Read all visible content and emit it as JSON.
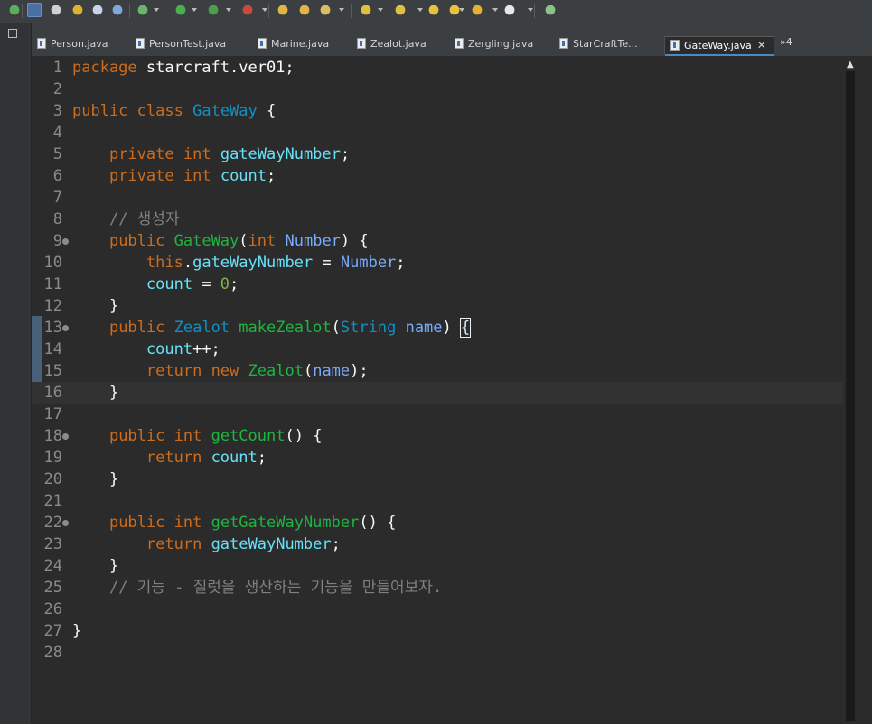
{
  "toolbar": {
    "buttons": [
      "debug-icon",
      "wand-icon",
      "settings-icon",
      "package-icon",
      "document-icon",
      "pilcrow-icon",
      "bug-icon",
      "run-icon",
      "run-coverage-icon",
      "external-tools-icon",
      "open-folder-icon",
      "open-task-icon",
      "brush-icon",
      "next-annotation-icon",
      "previous-annotation-icon",
      "back-edit-icon",
      "forward-edit-icon",
      "back-icon",
      "forward-icon",
      "open-perspective-icon"
    ]
  },
  "tabs": [
    {
      "label": "Person.java",
      "active": false
    },
    {
      "label": "PersonTest.java",
      "active": false
    },
    {
      "label": "Marine.java",
      "active": false
    },
    {
      "label": "Zealot.java",
      "active": false
    },
    {
      "label": "Zergling.java",
      "active": false
    },
    {
      "label": "StarCraftTe...",
      "active": false
    },
    {
      "label": "GateWay.java",
      "active": true
    }
  ],
  "tabs_overflow": "»4",
  "editor": {
    "current_line": 16,
    "lines": [
      {
        "n": "1",
        "fold": false,
        "tokens": [
          [
            "kw",
            "package"
          ],
          [
            "pl",
            " starcraft.ver01;"
          ]
        ]
      },
      {
        "n": "2",
        "fold": false,
        "tokens": []
      },
      {
        "n": "3",
        "fold": false,
        "tokens": [
          [
            "kw",
            "public"
          ],
          [
            "pl",
            " "
          ],
          [
            "kw",
            "class"
          ],
          [
            "pl",
            " "
          ],
          [
            "ty",
            "GateWay"
          ],
          [
            "pl",
            " {"
          ]
        ]
      },
      {
        "n": "4",
        "fold": false,
        "tokens": []
      },
      {
        "n": "5",
        "fold": false,
        "tokens": [
          [
            "pl",
            "    "
          ],
          [
            "kw",
            "private"
          ],
          [
            "pl",
            " "
          ],
          [
            "kw",
            "int"
          ],
          [
            "pl",
            " "
          ],
          [
            "fd",
            "gateWayNumber"
          ],
          [
            "pl",
            ";"
          ]
        ]
      },
      {
        "n": "6",
        "fold": false,
        "tokens": [
          [
            "pl",
            "    "
          ],
          [
            "kw",
            "private"
          ],
          [
            "pl",
            " "
          ],
          [
            "kw",
            "int"
          ],
          [
            "pl",
            " "
          ],
          [
            "fd",
            "count"
          ],
          [
            "pl",
            ";"
          ]
        ]
      },
      {
        "n": "7",
        "fold": false,
        "tokens": []
      },
      {
        "n": "8",
        "fold": false,
        "tokens": [
          [
            "pl",
            "    "
          ],
          [
            "cm",
            "// 생성자"
          ]
        ]
      },
      {
        "n": "9",
        "fold": true,
        "tokens": [
          [
            "pl",
            "    "
          ],
          [
            "kw",
            "public"
          ],
          [
            "pl",
            " "
          ],
          [
            "me",
            "GateWay"
          ],
          [
            "pl",
            "("
          ],
          [
            "kw",
            "int"
          ],
          [
            "pl",
            " "
          ],
          [
            "pa",
            "Number"
          ],
          [
            "pl",
            ") {"
          ]
        ]
      },
      {
        "n": "10",
        "fold": false,
        "tokens": [
          [
            "pl",
            "        "
          ],
          [
            "kw",
            "this"
          ],
          [
            "pl",
            "."
          ],
          [
            "fd",
            "gateWayNumber"
          ],
          [
            "pl",
            " = "
          ],
          [
            "pa",
            "Number"
          ],
          [
            "pl",
            ";"
          ]
        ]
      },
      {
        "n": "11",
        "fold": false,
        "tokens": [
          [
            "pl",
            "        "
          ],
          [
            "fd",
            "count"
          ],
          [
            "pl",
            " = "
          ],
          [
            "nu",
            "0"
          ],
          [
            "pl",
            ";"
          ]
        ]
      },
      {
        "n": "12",
        "fold": false,
        "tokens": [
          [
            "pl",
            "    }"
          ]
        ]
      },
      {
        "n": "13",
        "fold": true,
        "tokens": [
          [
            "pl",
            "    "
          ],
          [
            "kw",
            "public"
          ],
          [
            "pl",
            " "
          ],
          [
            "ty",
            "Zealot"
          ],
          [
            "pl",
            " "
          ],
          [
            "me",
            "makeZealot"
          ],
          [
            "pl",
            "("
          ],
          [
            "ty",
            "String"
          ],
          [
            "pl",
            " "
          ],
          [
            "pa",
            "name"
          ],
          [
            "pl",
            ") "
          ],
          [
            "bm",
            "{"
          ]
        ]
      },
      {
        "n": "14",
        "fold": false,
        "tokens": [
          [
            "pl",
            "        "
          ],
          [
            "fd",
            "count"
          ],
          [
            "pl",
            "++;"
          ]
        ]
      },
      {
        "n": "15",
        "fold": false,
        "tokens": [
          [
            "pl",
            "        "
          ],
          [
            "kw",
            "return"
          ],
          [
            "pl",
            " "
          ],
          [
            "kw",
            "new"
          ],
          [
            "pl",
            " "
          ],
          [
            "cl",
            "Zealot"
          ],
          [
            "pl",
            "("
          ],
          [
            "pa",
            "name"
          ],
          [
            "pl",
            ");"
          ]
        ]
      },
      {
        "n": "16",
        "fold": false,
        "tokens": [
          [
            "pl",
            "    }"
          ]
        ]
      },
      {
        "n": "17",
        "fold": false,
        "tokens": []
      },
      {
        "n": "18",
        "fold": true,
        "tokens": [
          [
            "pl",
            "    "
          ],
          [
            "kw",
            "public"
          ],
          [
            "pl",
            " "
          ],
          [
            "kw",
            "int"
          ],
          [
            "pl",
            " "
          ],
          [
            "me",
            "getCount"
          ],
          [
            "pl",
            "() {"
          ]
        ]
      },
      {
        "n": "19",
        "fold": false,
        "tokens": [
          [
            "pl",
            "        "
          ],
          [
            "kw",
            "return"
          ],
          [
            "pl",
            " "
          ],
          [
            "fd",
            "count"
          ],
          [
            "pl",
            ";"
          ]
        ]
      },
      {
        "n": "20",
        "fold": false,
        "tokens": [
          [
            "pl",
            "    }"
          ]
        ]
      },
      {
        "n": "21",
        "fold": false,
        "tokens": []
      },
      {
        "n": "22",
        "fold": true,
        "tokens": [
          [
            "pl",
            "    "
          ],
          [
            "kw",
            "public"
          ],
          [
            "pl",
            " "
          ],
          [
            "kw",
            "int"
          ],
          [
            "pl",
            " "
          ],
          [
            "me",
            "getGateWayNumber"
          ],
          [
            "pl",
            "() {"
          ]
        ]
      },
      {
        "n": "23",
        "fold": false,
        "tokens": [
          [
            "pl",
            "        "
          ],
          [
            "kw",
            "return"
          ],
          [
            "pl",
            " "
          ],
          [
            "fd",
            "gateWayNumber"
          ],
          [
            "pl",
            ";"
          ]
        ]
      },
      {
        "n": "24",
        "fold": false,
        "tokens": [
          [
            "pl",
            "    }"
          ]
        ]
      },
      {
        "n": "25",
        "fold": false,
        "tokens": [
          [
            "pl",
            "    "
          ],
          [
            "cm",
            "// 기능 - 질럿을 생산하는 기능을 만들어보자."
          ]
        ]
      },
      {
        "n": "26",
        "fold": false,
        "tokens": []
      },
      {
        "n": "27",
        "fold": false,
        "tokens": [
          [
            "pl",
            "}"
          ]
        ]
      },
      {
        "n": "28",
        "fold": false,
        "tokens": []
      }
    ]
  }
}
